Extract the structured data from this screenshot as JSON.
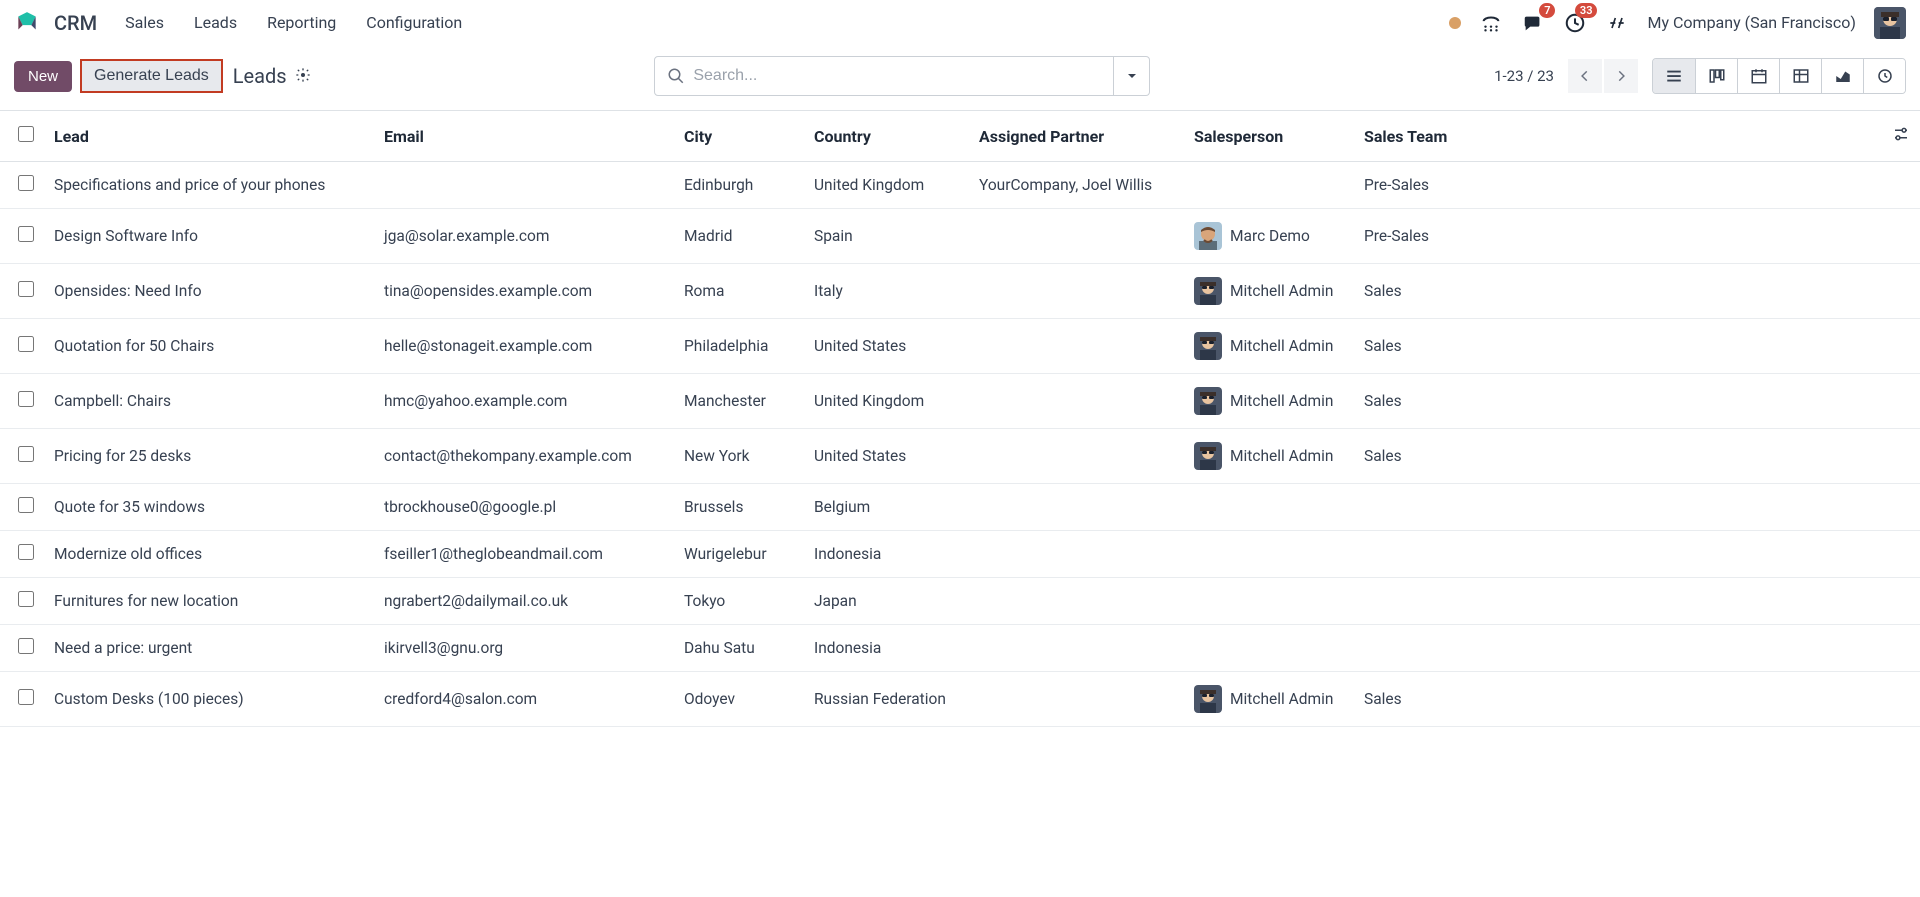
{
  "app": "CRM",
  "menus": [
    "Sales",
    "Leads",
    "Reporting",
    "Configuration"
  ],
  "header_badges": {
    "messages": "7",
    "activities": "33"
  },
  "company": "My Company (San Francisco)",
  "ctrl": {
    "new": "New",
    "generate": "Generate Leads",
    "breadcrumb": "Leads",
    "search_placeholder": "Search...",
    "pager": "1-23 / 23"
  },
  "columns": [
    "Lead",
    "Email",
    "City",
    "Country",
    "Assigned Partner",
    "Salesperson",
    "Sales Team"
  ],
  "avatars": {
    "marc": "marc",
    "mitchell": "mitchell"
  },
  "rows": [
    {
      "lead": "Specifications and price of your phones",
      "email": "",
      "city": "Edinburgh",
      "country": "United Kingdom",
      "partner": "YourCompany, Joel Willis",
      "sp": "",
      "sp_av": "",
      "team": "Pre-Sales"
    },
    {
      "lead": "Design Software Info",
      "email": "jga@solar.example.com",
      "city": "Madrid",
      "country": "Spain",
      "partner": "",
      "sp": "Marc Demo",
      "sp_av": "marc",
      "team": "Pre-Sales"
    },
    {
      "lead": "Opensides: Need Info",
      "email": "tina@opensides.example.com",
      "city": "Roma",
      "country": "Italy",
      "partner": "",
      "sp": "Mitchell Admin",
      "sp_av": "mitchell",
      "team": "Sales"
    },
    {
      "lead": "Quotation for 50 Chairs",
      "email": "helle@stonageit.example.com",
      "city": "Philadelphia",
      "country": "United States",
      "partner": "",
      "sp": "Mitchell Admin",
      "sp_av": "mitchell",
      "team": "Sales"
    },
    {
      "lead": "Campbell: Chairs",
      "email": "hmc@yahoo.example.com",
      "city": "Manchester",
      "country": "United Kingdom",
      "partner": "",
      "sp": "Mitchell Admin",
      "sp_av": "mitchell",
      "team": "Sales"
    },
    {
      "lead": "Pricing for 25 desks",
      "email": "contact@thekompany.example.com",
      "city": "New York",
      "country": "United States",
      "partner": "",
      "sp": "Mitchell Admin",
      "sp_av": "mitchell",
      "team": "Sales"
    },
    {
      "lead": "Quote for 35 windows",
      "email": "tbrockhouse0@google.pl",
      "city": "Brussels",
      "country": "Belgium",
      "partner": "",
      "sp": "",
      "sp_av": "",
      "team": ""
    },
    {
      "lead": "Modernize old offices",
      "email": "fseiller1@theglobeandmail.com",
      "city": "Wurigelebur",
      "country": "Indonesia",
      "partner": "",
      "sp": "",
      "sp_av": "",
      "team": ""
    },
    {
      "lead": "Furnitures for new location",
      "email": "ngrabert2@dailymail.co.uk",
      "city": "Tokyo",
      "country": "Japan",
      "partner": "",
      "sp": "",
      "sp_av": "",
      "team": ""
    },
    {
      "lead": "Need a price: urgent",
      "email": "ikirvell3@gnu.org",
      "city": "Dahu Satu",
      "country": "Indonesia",
      "partner": "",
      "sp": "",
      "sp_av": "",
      "team": ""
    },
    {
      "lead": "Custom Desks (100 pieces)",
      "email": "credford4@salon.com",
      "city": "Odoyev",
      "country": "Russian Federation",
      "partner": "",
      "sp": "Mitchell Admin",
      "sp_av": "mitchell",
      "team": "Sales"
    }
  ]
}
